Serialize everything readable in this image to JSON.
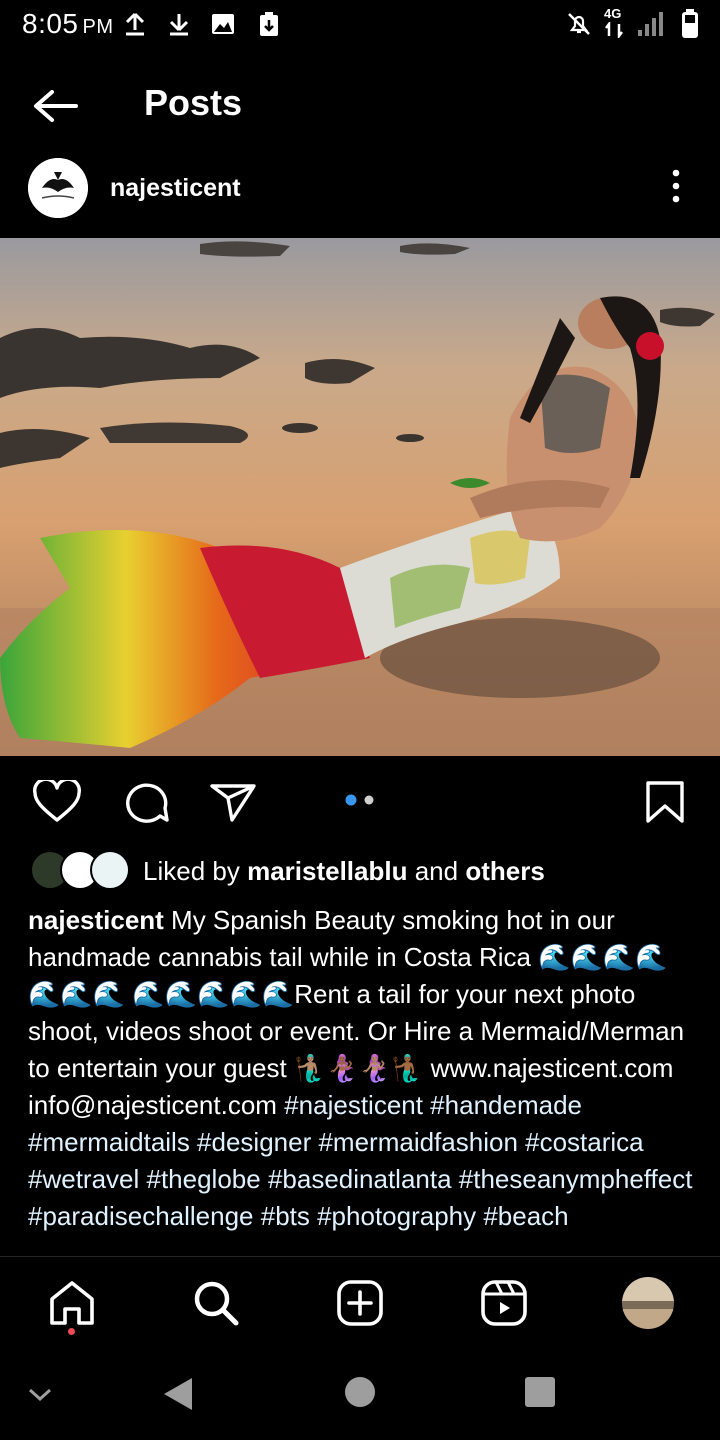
{
  "status_bar": {
    "time": "8:05",
    "ampm": "PM",
    "network": "4G"
  },
  "header": {
    "title": "Posts"
  },
  "post": {
    "username": "najesticent",
    "carousel": {
      "current": 1,
      "total": 2
    },
    "likes": {
      "prefix": "Liked by ",
      "user": "maristellablu",
      "middle": " and ",
      "others": "others"
    },
    "caption": {
      "username": "najesticent",
      "text": " My Spanish Beauty smoking hot in our handmade cannabis tail while in Costa Rica 🌊🌊🌊🌊🌊🌊🌊 🌊🌊🌊🌊🌊Rent a tail for your next photo shoot, videos shoot or event. Or Hire a Mermaid/Merman to entertain your guest 🧜🏽‍♂️🧜🏾‍♀️🧜🏽‍♀️🧜🏾‍♂️ www.najesticent.com info@najesticent.com",
      "hashtags": "#najesticent #handemade #mermaidtails #designer #mermaidfashion #costarica #wetravel #theglobe #basedinatlanta #theseanympheffect #paradisechallenge #bts #photography #beach"
    }
  },
  "colors": {
    "background": "#000000",
    "text": "#ffffff",
    "carousel_active": "#3897f0",
    "notification_dot": "#ed4956"
  },
  "icons": {
    "back": "arrow-left-icon",
    "more": "more-vertical-icon",
    "like": "heart-icon",
    "comment": "comment-icon",
    "share": "send-icon",
    "save": "bookmark-icon",
    "home": "home-icon",
    "search": "search-icon",
    "create": "plus-square-icon",
    "reels": "reels-icon"
  }
}
